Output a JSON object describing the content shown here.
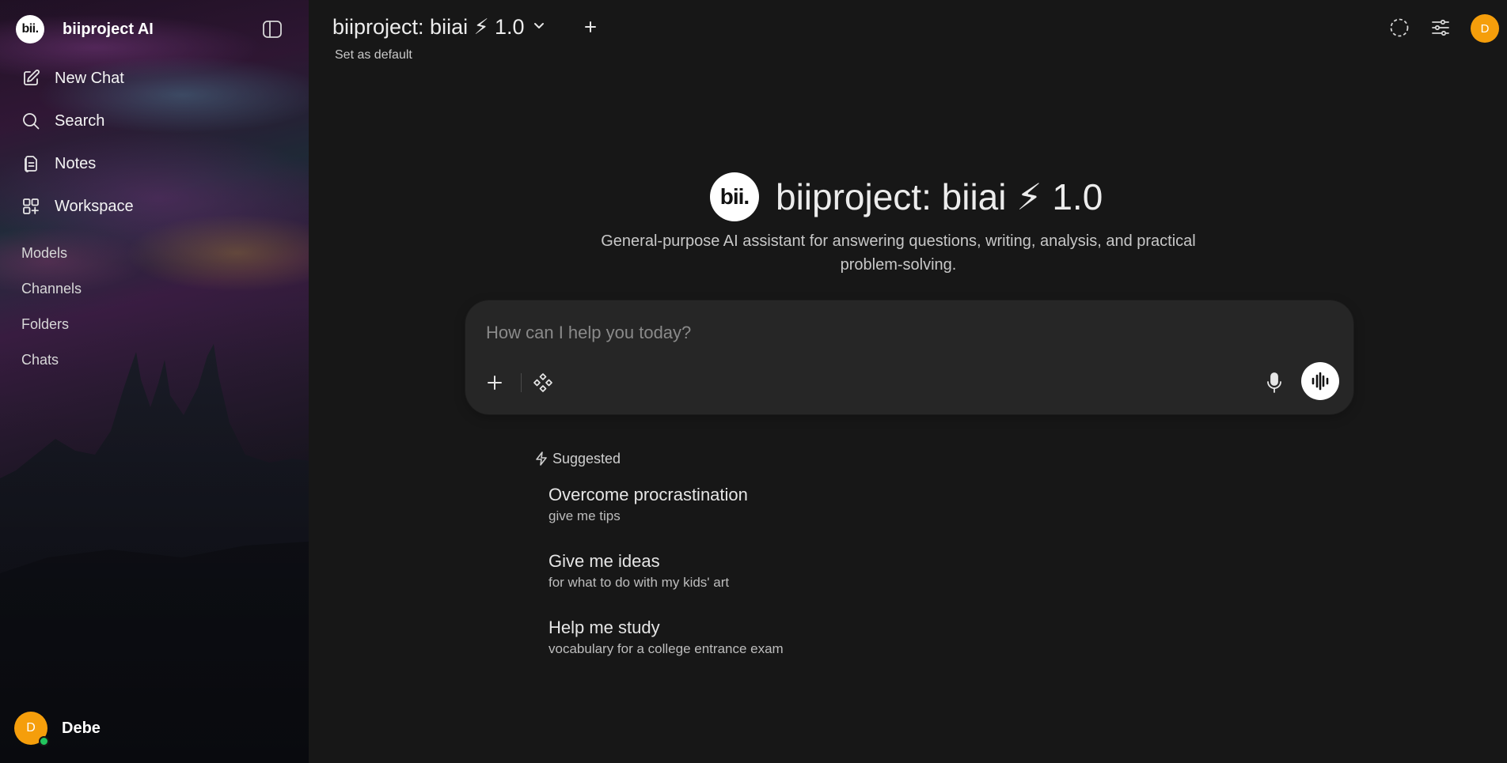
{
  "sidebar": {
    "brand_name": "biiproject AI",
    "logo_text": "bii.",
    "nav": [
      {
        "label": "New Chat",
        "icon": "pencil-square-icon"
      },
      {
        "label": "Search",
        "icon": "search-icon"
      },
      {
        "label": "Notes",
        "icon": "notes-icon"
      },
      {
        "label": "Workspace",
        "icon": "workspace-icon"
      }
    ],
    "sections": [
      "Models",
      "Channels",
      "Folders",
      "Chats"
    ],
    "user": {
      "initial": "D",
      "name": "Debe",
      "status": "online"
    }
  },
  "header": {
    "model_name": "biiproject: biiai ⚡ 1.0",
    "set_default": "Set as default",
    "avatar_initial": "D"
  },
  "hero": {
    "logo_text": "bii.",
    "title": "biiproject: biiai ⚡ 1.0",
    "description": "General-purpose AI assistant for answering questions, writing, analysis, and practical problem-solving."
  },
  "composer": {
    "placeholder": "How can I help you today?",
    "value": ""
  },
  "suggested": {
    "header": "Suggested",
    "items": [
      {
        "title": "Overcome procrastination",
        "subtitle": "give me tips"
      },
      {
        "title": "Give me ideas",
        "subtitle": "for what to do with my kids' art"
      },
      {
        "title": "Help me study",
        "subtitle": "vocabulary for a college entrance exam"
      }
    ]
  },
  "colors": {
    "background": "#171717",
    "composer": "#262626",
    "avatar": "#f59e0b",
    "online": "#22c55e"
  }
}
